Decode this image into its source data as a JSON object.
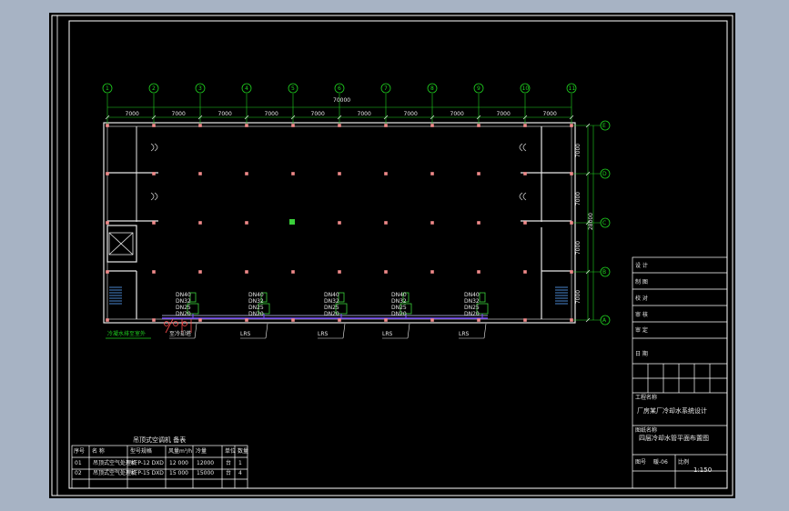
{
  "drawing": {
    "colors": {
      "background": "#a7b3c4",
      "sheet": "#000000",
      "frame": "#ffffff",
      "grid_bubble": "#1fd21f",
      "column": "#f08a8a",
      "pipe": "#7b4dff",
      "unit": "#3ad03a"
    },
    "grid_axes_top": [
      "1",
      "2",
      "3",
      "4",
      "5",
      "6",
      "7",
      "8",
      "9",
      "10",
      "11"
    ],
    "grid_axes_right": [
      "A",
      "B",
      "C",
      "D",
      "E"
    ],
    "overall_dim_top": "70000",
    "bay_dims_top": [
      "7000",
      "7000",
      "7000",
      "7000",
      "7000",
      "7000",
      "7000",
      "7000",
      "7000",
      "7000"
    ],
    "bay_dims_right": [
      "7000",
      "7000",
      "7000",
      "7000"
    ],
    "overall_dim_right": "28000",
    "unit_labels": [
      "DN40",
      "DN32",
      "DN25",
      "DN20"
    ],
    "riser_labels": [
      "至冷却塔",
      "LRS",
      "LRS",
      "LRS",
      "LRS"
    ],
    "side_note": "冷凝水排至室外"
  },
  "equipment_table": {
    "title": "吊顶式空调机 备表",
    "headers": [
      "序号",
      "名  称",
      "型号规格",
      "风量m³/h",
      "冷量",
      "单位",
      "数量"
    ],
    "rows": [
      [
        "01",
        "吊顶式空气处理机",
        "KFP-12 DXD",
        "12 000",
        "12000",
        "台",
        "1"
      ],
      [
        "02",
        "吊顶式空气处理机",
        "KFP-15 DXD",
        "15 000",
        "15000",
        "台",
        "4"
      ]
    ]
  },
  "title_block": {
    "rows": [
      "设  计",
      "制  图",
      "校  对",
      "审  核",
      "审  定",
      "日  期"
    ],
    "project_label": "工程名称",
    "project_name": "厂房某厂冷却水系统设计",
    "drawing_label": "图纸名称",
    "drawing_name": "四层冷却水管平面布置图",
    "scale_label": "比例",
    "scale": "1:150",
    "sheet_label": "图号",
    "sheet_no": "暖-06"
  }
}
